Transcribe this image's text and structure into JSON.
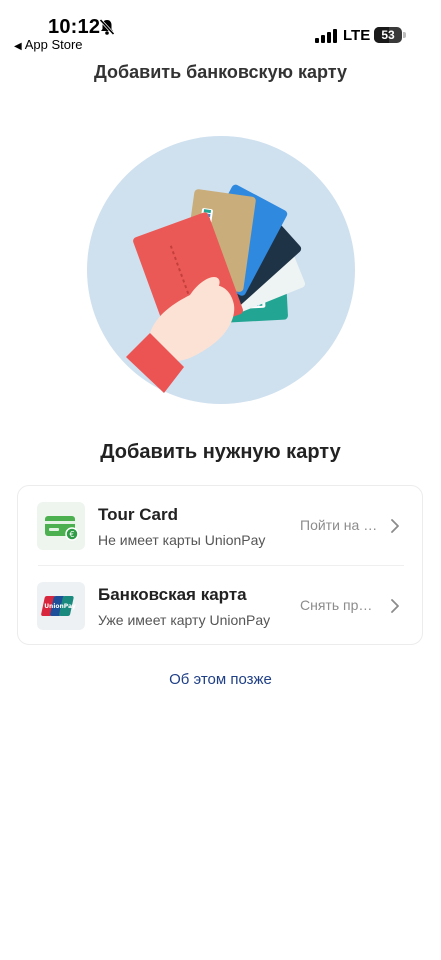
{
  "status_bar": {
    "time": "10:12",
    "back_app": "App Store",
    "network": "LTE",
    "battery": "53",
    "battery_level": 0.53
  },
  "header": {
    "title": "Добавить банковскую карту"
  },
  "illustration": {
    "icon": "hand-holding-cards-illustration",
    "colors": {
      "circle": "#cfe0ef",
      "sleeve": "#ec5353",
      "hand": "#fbe2d5",
      "red_card": "#ea5955",
      "gold_card": "#c9ad7b",
      "blue_card": "#2f89df",
      "navy_card": "#1e3346",
      "teal_card": "#22a593"
    }
  },
  "main": {
    "section_title": "Добавить нужную карту",
    "options": [
      {
        "icon": "green-card-icon",
        "title": "Tour Card",
        "subtitle": "Не имеет карты UnionPay",
        "action": "Пойти на кассу"
      },
      {
        "icon": "unionpay-card-icon",
        "title": "Банковская карта",
        "subtitle": "Уже имеет карту UnionPay",
        "action": "Снять привязку"
      }
    ],
    "later_link": "Об этом позже"
  },
  "theme": {
    "link_color": "#1f3f86",
    "muted_text": "#8c8c8c"
  }
}
